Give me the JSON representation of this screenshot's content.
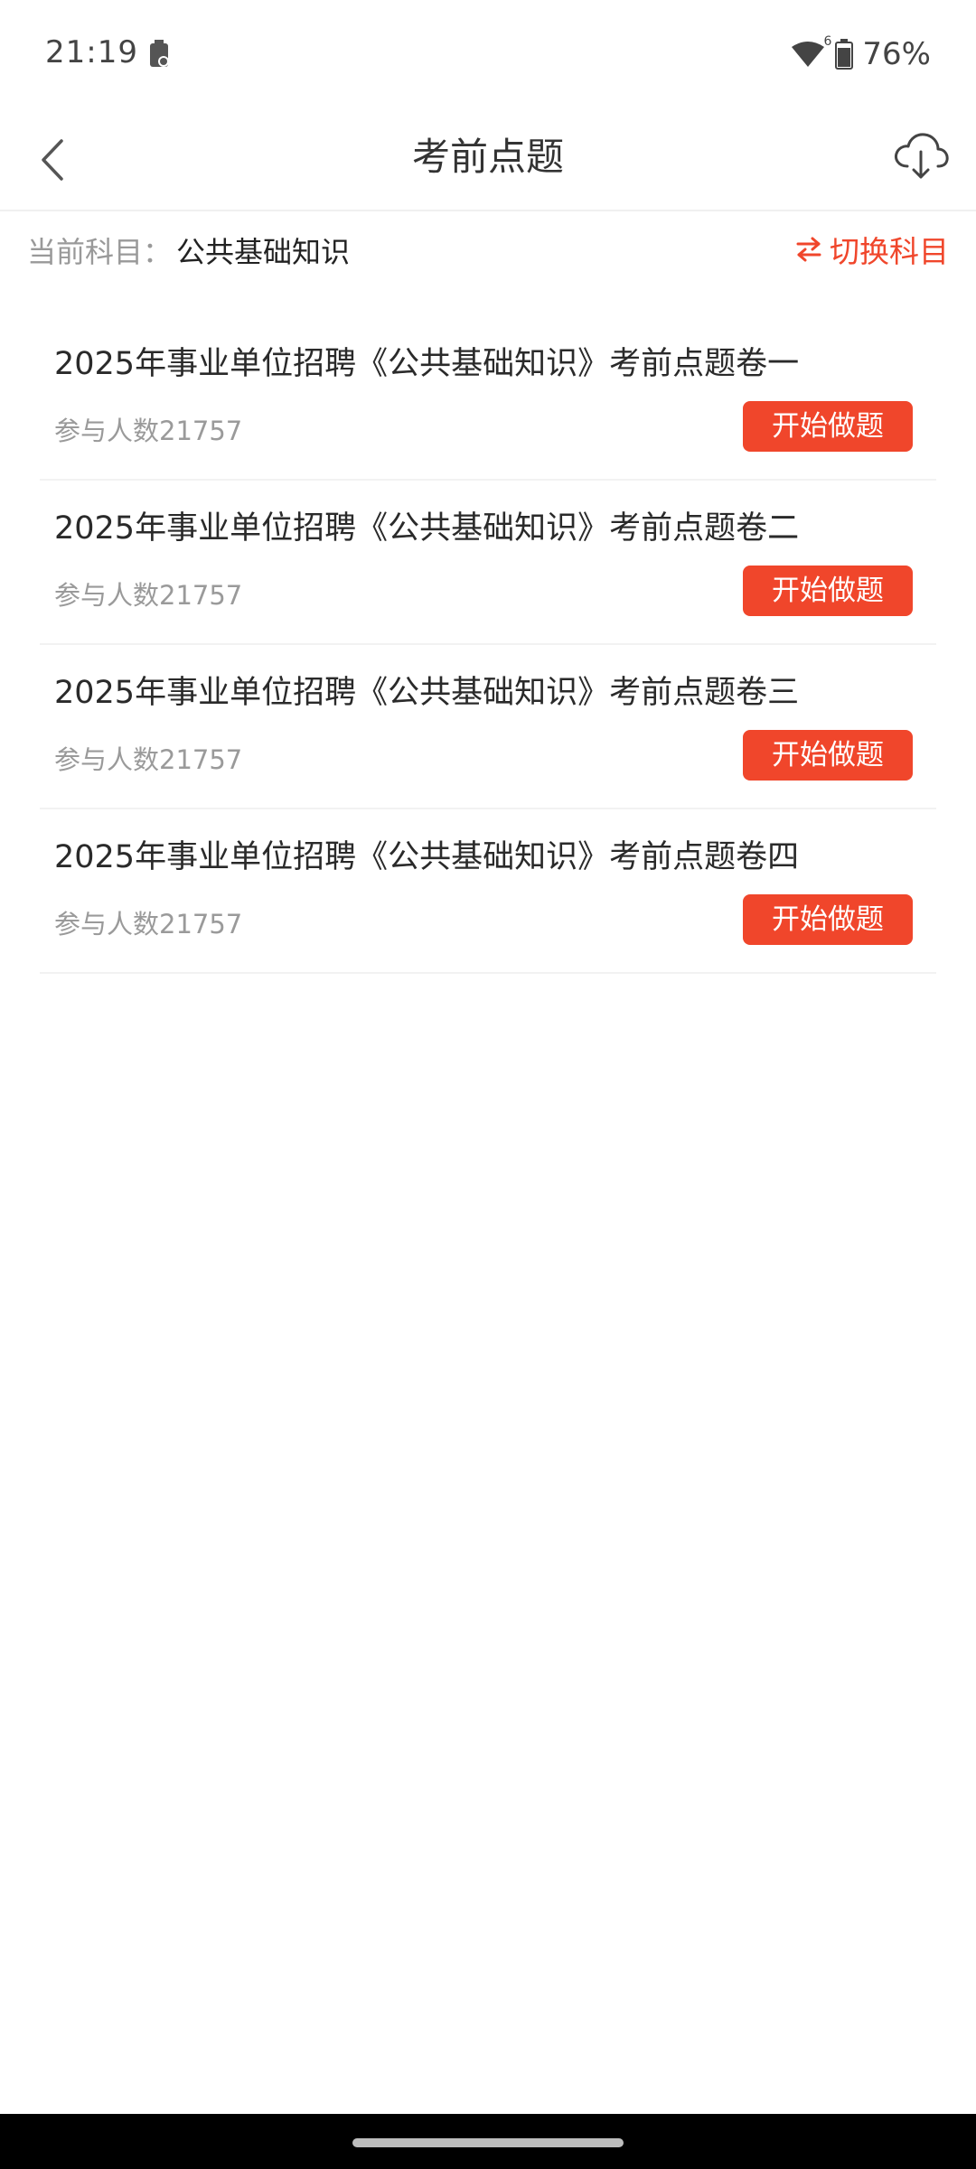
{
  "status_bar": {
    "time": "21:19",
    "battery": "76%",
    "signal_label": "6"
  },
  "nav": {
    "title": "考前点题"
  },
  "subject": {
    "label": "当前科目：",
    "value": "公共基础知识",
    "switch_label": "切换科目"
  },
  "exams": [
    {
      "title": "2025年事业单位招聘《公共基础知识》考前点题卷一",
      "participants": "参与人数21757",
      "button": "开始做题"
    },
    {
      "title": "2025年事业单位招聘《公共基础知识》考前点题卷二",
      "participants": "参与人数21757",
      "button": "开始做题"
    },
    {
      "title": "2025年事业单位招聘《公共基础知识》考前点题卷三",
      "participants": "参与人数21757",
      "button": "开始做题"
    },
    {
      "title": "2025年事业单位招聘《公共基础知识》考前点题卷四",
      "participants": "参与人数21757",
      "button": "开始做题"
    }
  ],
  "colors": {
    "accent": "#f0462b",
    "text_primary": "#2a2a2a",
    "text_secondary": "#9a9a9a"
  },
  "icons": {
    "back": "chevron-left-icon",
    "download": "cloud-download-icon",
    "switch": "swap-arrows-icon",
    "wifi": "wifi-icon",
    "battery": "battery-icon",
    "notification": "battery-saver-icon"
  }
}
